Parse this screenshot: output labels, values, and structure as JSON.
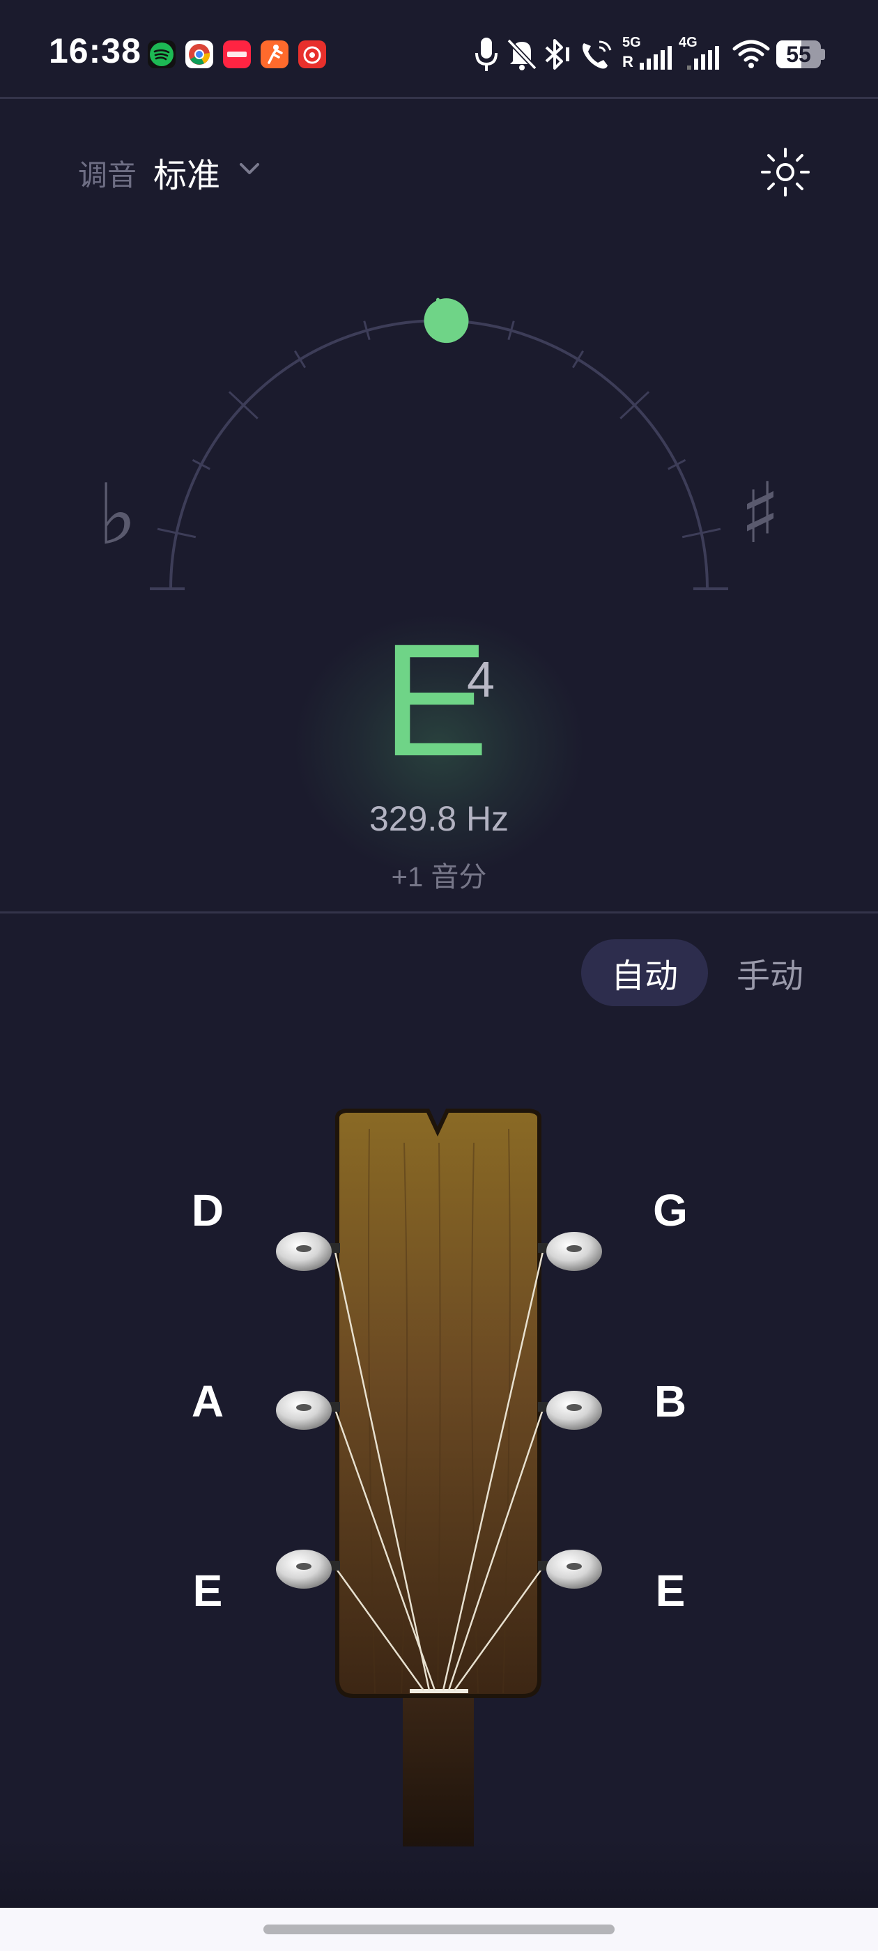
{
  "status_bar": {
    "time": "16:38",
    "app_icons": [
      "spotify-icon",
      "chrome-icon",
      "xiaohongshu-icon",
      "fitness-app-icon",
      "netease-music-icon"
    ],
    "app_icon_colors": [
      "#1db954",
      "#ffffff",
      "#ff2442",
      "#ff6a2c",
      "#e8302c"
    ],
    "status_icons": [
      "microphone-icon",
      "mute-icon",
      "bluetooth-icon",
      "wifi-call-icon",
      "signal-5g-icon",
      "signal-4g-icon",
      "wifi-icon",
      "battery-icon"
    ],
    "net_label_1": "5G",
    "net_sub_1": "R",
    "net_label_2": "4G",
    "battery_level": "55"
  },
  "header": {
    "tuning_label": "调音",
    "tuning_value": "标准",
    "settings_icon": "sun-settings-icon"
  },
  "gauge": {
    "flat_symbol": "♭",
    "sharp_symbol": "♯",
    "deviation_cents": 1,
    "indicator_color": "#6fd487",
    "arc_color": "#3d3d58"
  },
  "note": {
    "name": "E",
    "octave": "4",
    "frequency": "329.8 Hz",
    "cents": "+1 音分",
    "accent_color": "#6fd487"
  },
  "mode_toggle": {
    "auto_label": "自动",
    "manual_label": "手动",
    "selected": "auto"
  },
  "strings": {
    "left": [
      "D",
      "A",
      "E"
    ],
    "right": [
      "G",
      "B",
      "E"
    ]
  }
}
